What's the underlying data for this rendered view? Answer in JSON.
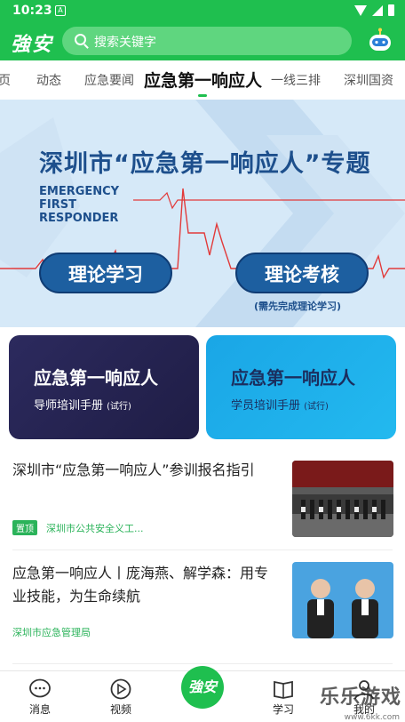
{
  "status": {
    "time": "10:23",
    "notif_icon": "A"
  },
  "header": {
    "logo_text": "強安",
    "search_placeholder": "搜索关键字",
    "brand_color": "#1fbf4f"
  },
  "tabs": [
    {
      "label": "页"
    },
    {
      "label": "动态"
    },
    {
      "label": "应急要闻"
    },
    {
      "label": "应急第一响应人",
      "active": true
    },
    {
      "label": "一线三排"
    },
    {
      "label": "深圳国资"
    }
  ],
  "banner": {
    "title": "深圳市“应急第一响应人”专题",
    "en_line1": "EMERGENCY",
    "en_line2": "FIRST",
    "en_line3": "RESPONDER",
    "btn_study": "理论学习",
    "btn_exam": "理论考核",
    "exam_note": "(需先完成理论学习)"
  },
  "cards": [
    {
      "title": "应急第一响应人",
      "sub": "导师培训手册",
      "sub_small": "(试行)"
    },
    {
      "title": "应急第一响应人",
      "sub": "学员培训手册",
      "sub_small": "(试行)"
    }
  ],
  "news": [
    {
      "title": "深圳市“应急第一响应人”参训报名指引",
      "tag": "置顶",
      "source": "深圳市公共安全义工..."
    },
    {
      "title": "应急第一响应人丨庞海燕、解学森：用专业技能，为生命续航",
      "source": "深圳市应急管理局"
    }
  ],
  "bottom_nav": [
    {
      "label": "消息"
    },
    {
      "label": "视频"
    },
    {
      "label": "強安"
    },
    {
      "label": "学习"
    },
    {
      "label": "我的"
    }
  ],
  "watermark": {
    "text": "乐乐游戏",
    "url": "www.6kk.com"
  }
}
